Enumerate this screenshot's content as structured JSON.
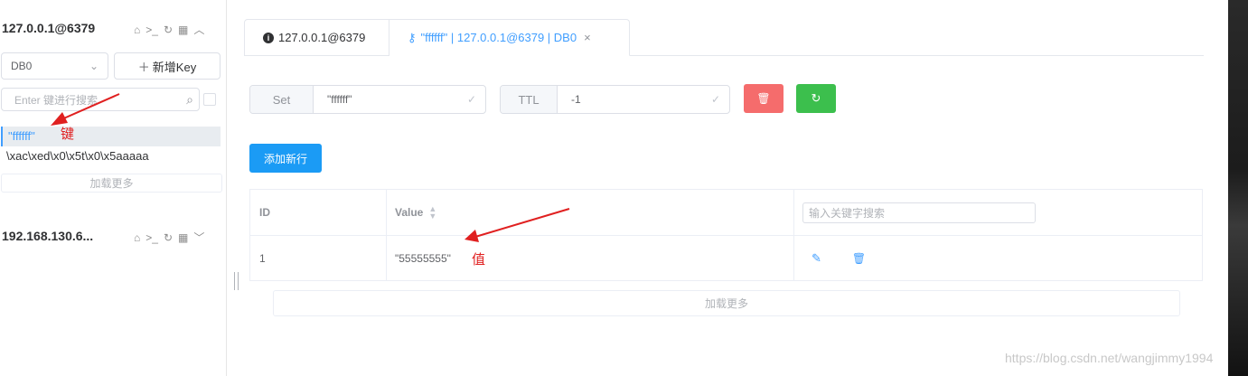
{
  "connections": [
    {
      "name": "127.0.0.1@6379"
    },
    {
      "name": "192.168.130.6..."
    }
  ],
  "db_select": {
    "value": "DB0"
  },
  "new_key_button": {
    "label": "新增Key"
  },
  "key_search": {
    "placeholder": "Enter 键进行搜索"
  },
  "keys": [
    "\"ffffff\"",
    "\\xac\\xed\\x0\\x5t\\x0\\x5aaaaa"
  ],
  "sidebar_load_more": "加载更多",
  "tabs": [
    {
      "label": "127.0.0.1@6379"
    },
    {
      "label": "\"ffffff\" | 127.0.0.1@6379 | DB0",
      "close": "×"
    }
  ],
  "key_type": {
    "label": "Set",
    "value": "\"ffffff\""
  },
  "ttl": {
    "label": "TTL",
    "value": "-1"
  },
  "add_row_button": {
    "label": "添加新行"
  },
  "table": {
    "headers": {
      "id": "ID",
      "value": "Value"
    },
    "search_placeholder": "输入关键字搜索",
    "rows": [
      {
        "id": "1",
        "value": "\"55555555\""
      }
    ]
  },
  "table_load_more": "加载更多",
  "annotations": {
    "key_label": "键",
    "value_label": "值"
  },
  "watermark": "https://blog.csdn.net/wangjimmy1994",
  "colors": {
    "accent": "#409eff",
    "danger": "#f56c6c",
    "success": "#3cbf4d",
    "primary_btn": "#1b9bf5",
    "annotation": "#e02020"
  }
}
